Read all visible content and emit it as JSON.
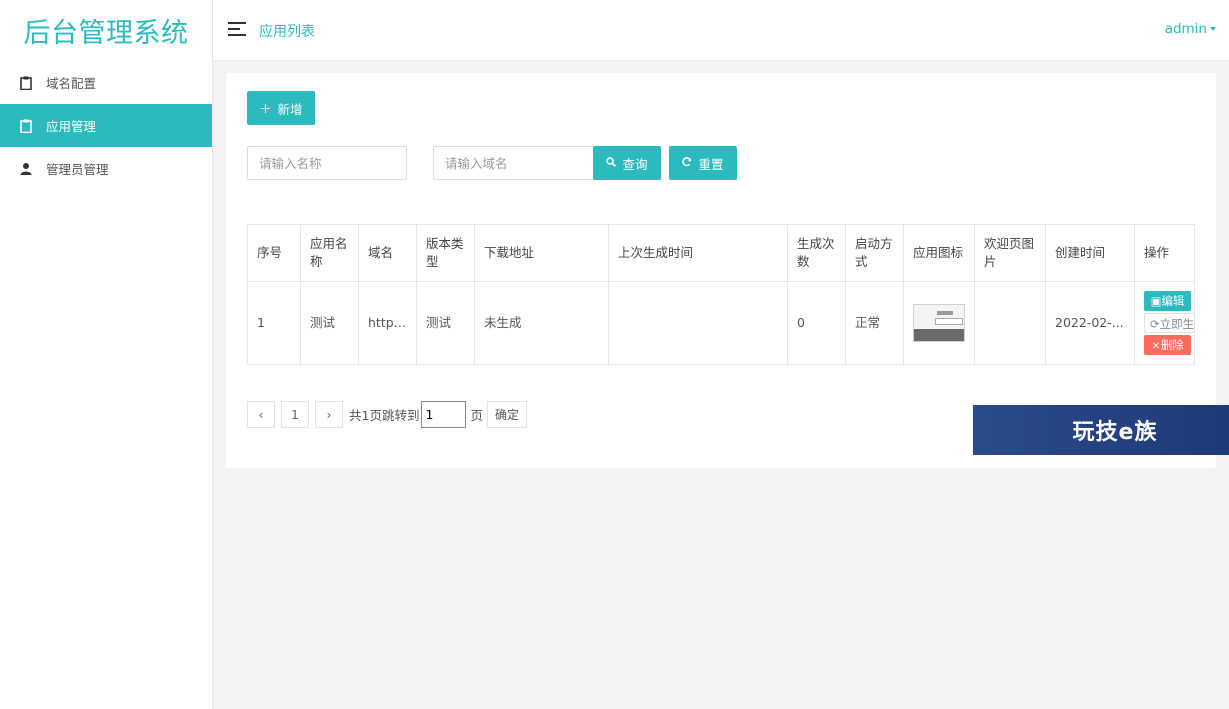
{
  "brand": {
    "logo_text": "后台管理系统"
  },
  "sidebar": {
    "items": [
      {
        "label": "域名配置",
        "icon": "clipboard-icon",
        "active": false
      },
      {
        "label": "应用管理",
        "icon": "clipboard-icon",
        "active": true
      },
      {
        "label": "管理员管理",
        "icon": "user-icon",
        "active": false
      }
    ]
  },
  "header": {
    "breadcrumb": "应用列表",
    "user": "admin"
  },
  "toolbar": {
    "add_label": "新增",
    "name_placeholder": "请输入名称",
    "domain_placeholder": "请输入域名",
    "search_label": "查询",
    "reset_label": "重置"
  },
  "table": {
    "columns": [
      "序号",
      "应用名称",
      "域名",
      "版本类型",
      "下载地址",
      "上次生成时间",
      "生成次数",
      "启动方式",
      "应用图标",
      "欢迎页图片",
      "创建时间",
      "操作"
    ],
    "rows": [
      {
        "index": "1",
        "name": "测试",
        "domain": "http:...",
        "version": "测试",
        "download": "未生成",
        "last_generated": "",
        "gen_count": "0",
        "launch": "正常",
        "welcome": "",
        "created": "2022-02-...",
        "actions": {
          "edit": "编辑",
          "generate": "立即生",
          "delete": "删除"
        }
      }
    ]
  },
  "pagination": {
    "current_page": "1",
    "summary": "共1页跳转到",
    "jump_value": "1",
    "page_suffix": "页",
    "confirm_label": "确定"
  },
  "watermark": {
    "text": "玩技e族"
  },
  "colors": {
    "accent": "#2bbbbf",
    "danger": "#ff6a5b",
    "background": "#f2f3f5"
  }
}
